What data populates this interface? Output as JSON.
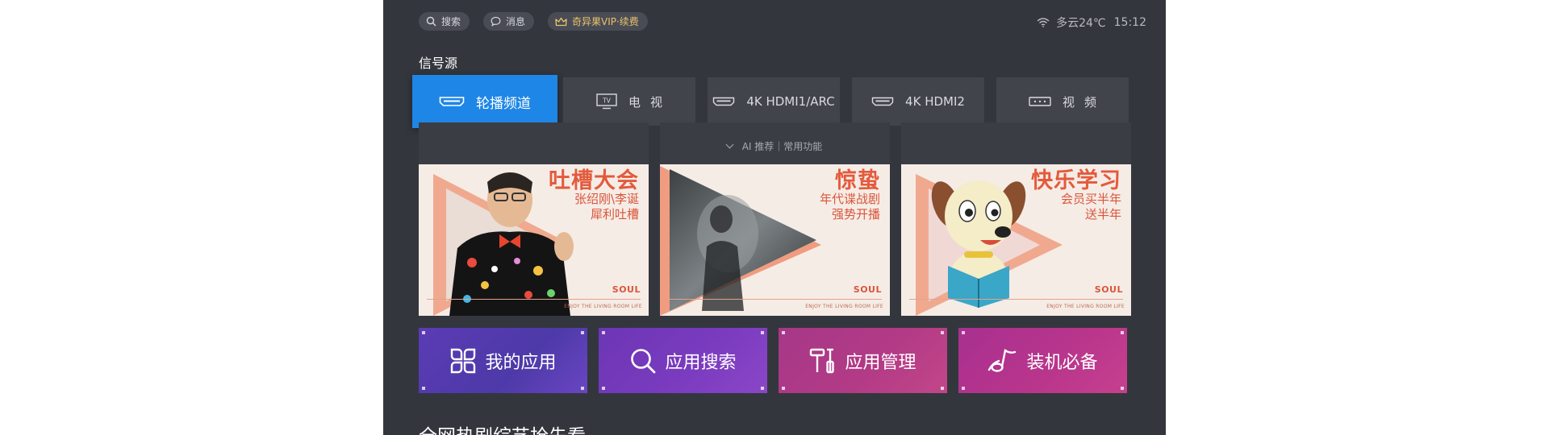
{
  "topbar": {
    "search_label": "搜索",
    "messages_label": "消息",
    "vip_label": "奇异果VIP·续费",
    "weather": "多云24℃",
    "time": "15:12"
  },
  "signal_source": {
    "title": "信号源",
    "tabs": [
      {
        "label": "轮播频道",
        "icon": "hdmi-icon",
        "active": true
      },
      {
        "label": "电视",
        "icon": "tv-icon",
        "active": false
      },
      {
        "label": "4K HDMI1/ARC",
        "icon": "hdmi-icon",
        "active": false
      },
      {
        "label": "4K HDMI2",
        "icon": "hdmi-icon",
        "active": false
      },
      {
        "label": "视频",
        "icon": "video-icon",
        "active": false
      }
    ]
  },
  "ai_bar": {
    "label": "AI 推荐｜常用功能"
  },
  "cards": [
    {
      "title": "吐槽大会",
      "line1": "张绍刚\\李诞",
      "line2": "犀利吐槽",
      "brand": "SOUL",
      "slogan": "ENJOY THE LIVING ROOM LIFE"
    },
    {
      "title": "惊蛰",
      "line1": "年代谍战剧",
      "line2": "强势开播",
      "brand": "SOUL",
      "slogan": "ENJOY THE LIVING ROOM LIFE"
    },
    {
      "title": "快乐学习",
      "line1": "会员买半年",
      "line2": "送半年",
      "brand": "SOUL",
      "slogan": "ENJOY THE LIVING ROOM LIFE"
    }
  ],
  "apps": [
    {
      "label": "我的应用",
      "icon": "apps-grid-icon",
      "color": "#5b3bb5"
    },
    {
      "label": "应用搜索",
      "icon": "search-icon",
      "color": "#7a3bbf"
    },
    {
      "label": "应用管理",
      "icon": "tools-icon",
      "color": "#b23a86"
    },
    {
      "label": "装机必备",
      "icon": "music-note-icon",
      "color": "#b8358c"
    }
  ],
  "hot_section": {
    "title": "全网热剧综艺抢先看"
  },
  "colors": {
    "background": "#34363e",
    "tab": "#42444c",
    "active_tab": "#1e86e6",
    "vip": "#e9c46a",
    "card_accent": "#e35a3c"
  }
}
